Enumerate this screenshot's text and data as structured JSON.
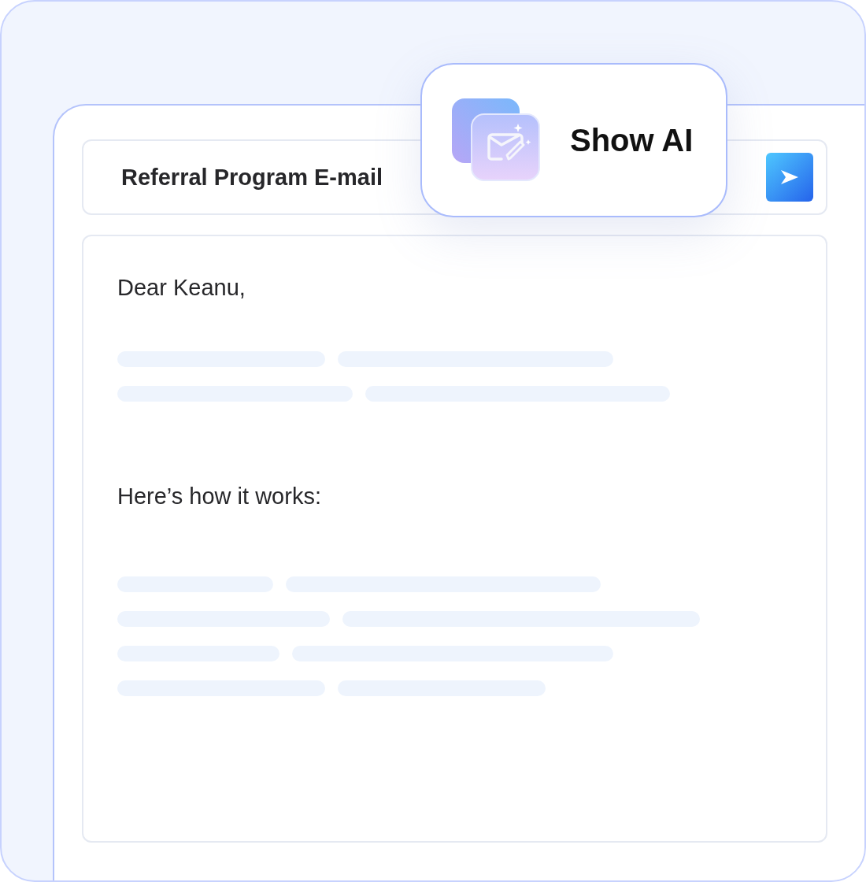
{
  "subject": "Referral Program E-mail",
  "body": [
    {
      "kind": "text",
      "text": "Dear Keanu,"
    },
    {
      "kind": "skeleton"
    },
    {
      "kind": "text",
      "text": "Here’s how it works:"
    },
    {
      "kind": "skeleton"
    }
  ],
  "overlay": {
    "label": "Show AI"
  }
}
